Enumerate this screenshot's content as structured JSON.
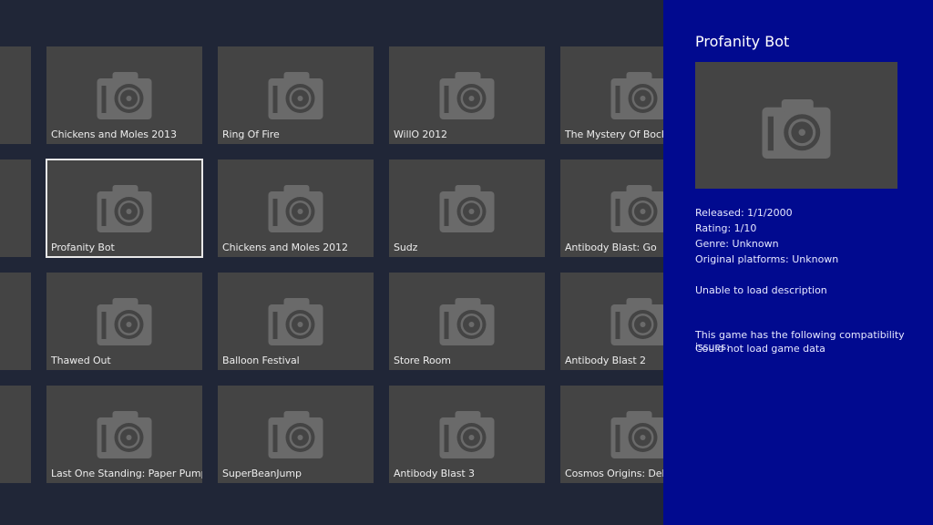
{
  "library": {
    "games": [
      {
        "title": ""
      },
      {
        "title": "Chickens and Moles 2013"
      },
      {
        "title": "Ring Of Fire"
      },
      {
        "title": "WillO 2012"
      },
      {
        "title": "The Mystery Of Bockstone"
      },
      {
        "title": ""
      },
      {
        "title": "Profanity Bot"
      },
      {
        "title": "Chickens and Moles 2012"
      },
      {
        "title": "Sudz"
      },
      {
        "title": "Antibody Blast: Go"
      },
      {
        "title": ""
      },
      {
        "title": "Thawed Out"
      },
      {
        "title": "Balloon Festival"
      },
      {
        "title": "Store Room"
      },
      {
        "title": "Antibody Blast 2"
      },
      {
        "title": ""
      },
      {
        "title": "Last One Standing: Paper Pumpkin Apocalypse"
      },
      {
        "title": "SuperBeanJump"
      },
      {
        "title": "Antibody Blast 3"
      },
      {
        "title": "Cosmos Origins: Delegate"
      }
    ],
    "selected_index": 6,
    "icon": "camera-icon"
  },
  "details": {
    "title": "Profanity Bot",
    "released": "Released: 1/1/2000",
    "rating": "Rating: 1/10",
    "genre": "Genre: Unknown",
    "platforms": "Original platforms: Unknown",
    "description": "Unable to load description",
    "compat_header": "This game has the following compatibility issues:",
    "compat_issue": "Could not load game data"
  },
  "colors": {
    "background": "#202637",
    "tile": "#444444",
    "icon": "#6a6a6a",
    "panel": "#010a8f",
    "selection": "#e8e8e8"
  }
}
